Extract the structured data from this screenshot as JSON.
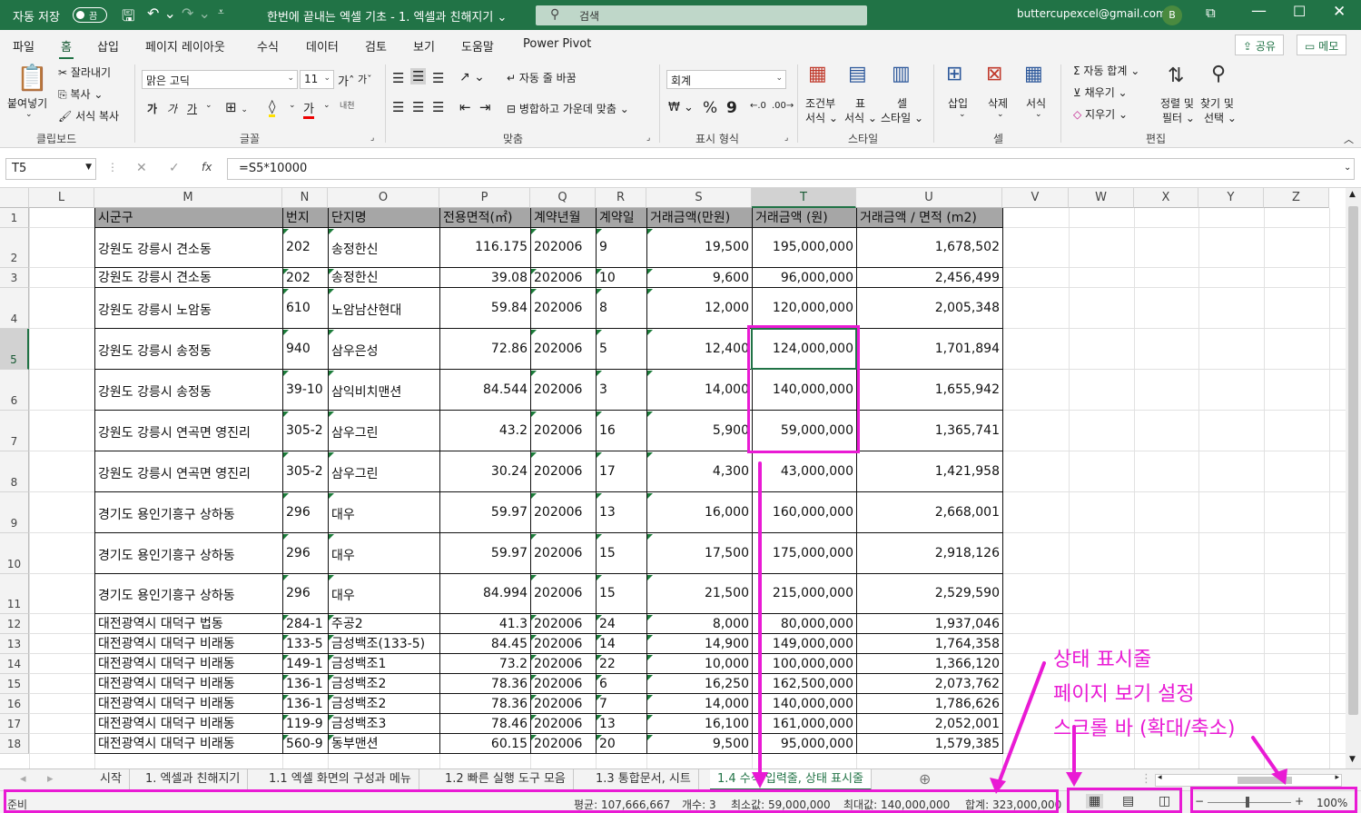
{
  "titlebar": {
    "autosave_label": "자동 저장",
    "autosave_state": "끔",
    "document_title": "한번에 끝내는 엑셀 기초 - 1. 엑셀과 친해지기",
    "search_placeholder": "검색",
    "account_email": "buttercupexcel@gmail.com",
    "avatar_initial": "B",
    "accent_color": "#217346"
  },
  "ribbon_tabs": [
    "파일",
    "홈",
    "삽입",
    "페이지 레이아웃",
    "수식",
    "데이터",
    "검토",
    "보기",
    "도움말",
    "Power Pivot"
  ],
  "share_label": "공유",
  "memo_label": "메모",
  "ribbon": {
    "clipboard": {
      "paste": "붙여넣기",
      "cut": "잘라내기",
      "copy": "복사",
      "format_painter": "서식 복사",
      "group": "클립보드"
    },
    "font": {
      "name": "맑은 고딕",
      "size": "11",
      "bold": "가",
      "italic": "가",
      "underline": "가",
      "phonetic": "내천",
      "group": "글꼴"
    },
    "alignment": {
      "wrap": "자동 줄 바꿈",
      "merge": "병합하고 가운데 맞춤",
      "group": "맞춤"
    },
    "number": {
      "format": "회계",
      "percent": "%",
      "comma": "9",
      "group": "표시 형식"
    },
    "styles": {
      "conditional": "조건부",
      "conditional2": "서식",
      "table": "표",
      "table2": "서식",
      "cell": "셀",
      "cell2": "스타일",
      "group": "스타일"
    },
    "cells": {
      "insert": "삽입",
      "delete": "삭제",
      "format": "서식",
      "group": "셀"
    },
    "editing": {
      "autosum": "자동 합계",
      "fill": "채우기",
      "clear": "지우기",
      "sort1": "정렬 및",
      "sort2": "필터",
      "find1": "찾기 및",
      "find2": "선택",
      "group": "편집"
    }
  },
  "formula_bar": {
    "name_box": "T5",
    "cancel": "✕",
    "enter": "✓",
    "fx": "fx",
    "formula": "=S5*10000"
  },
  "columns": [
    "L",
    "M",
    "N",
    "O",
    "P",
    "Q",
    "R",
    "S",
    "T",
    "U",
    "V",
    "W",
    "X",
    "Y",
    "Z"
  ],
  "table_header": [
    "시군구",
    "번지",
    "단지명",
    "전용면적(㎡)",
    "계약년월",
    "계약일",
    "거래금액(만원)",
    "거래금액 (원)",
    "거래금액 / 면적 (m2)"
  ],
  "rows": [
    {
      "n": "2",
      "cells": [
        "강원도 강릉시 견소동",
        "202",
        "송정한신",
        "116.175",
        "202006",
        "9",
        "19,500",
        "195,000,000",
        "1,678,502"
      ]
    },
    {
      "n": "3",
      "cells": [
        "강원도 강릉시 견소동",
        "202",
        "송정한신",
        "39.08",
        "202006",
        "10",
        "9,600",
        "96,000,000",
        "2,456,499"
      ]
    },
    {
      "n": "4",
      "cells": [
        "강원도 강릉시 노암동",
        "610",
        "노암남산현대",
        "59.84",
        "202006",
        "8",
        "12,000",
        "120,000,000",
        "2,005,348"
      ]
    },
    {
      "n": "5",
      "cells": [
        "강원도 강릉시 송정동",
        "940",
        "삼우은성",
        "72.86",
        "202006",
        "5",
        "12,400",
        "124,000,000",
        "1,701,894"
      ]
    },
    {
      "n": "6",
      "cells": [
        "강원도 강릉시 송정동",
        "39-10",
        "삼익비치맨션",
        "84.544",
        "202006",
        "3",
        "14,000",
        "140,000,000",
        "1,655,942"
      ]
    },
    {
      "n": "7",
      "cells": [
        "강원도 강릉시 연곡면 영진리",
        "305-2",
        "삼우그린",
        "43.2",
        "202006",
        "16",
        "5,900",
        "59,000,000",
        "1,365,741"
      ]
    },
    {
      "n": "8",
      "cells": [
        "강원도 강릉시 연곡면 영진리",
        "305-2",
        "삼우그린",
        "30.24",
        "202006",
        "17",
        "4,300",
        "43,000,000",
        "1,421,958"
      ]
    },
    {
      "n": "9",
      "cells": [
        "경기도 용인기흥구 상하동",
        "296",
        "대우",
        "59.97",
        "202006",
        "13",
        "16,000",
        "160,000,000",
        "2,668,001"
      ]
    },
    {
      "n": "10",
      "cells": [
        "경기도 용인기흥구 상하동",
        "296",
        "대우",
        "59.97",
        "202006",
        "15",
        "17,500",
        "175,000,000",
        "2,918,126"
      ]
    },
    {
      "n": "11",
      "cells": [
        "경기도 용인기흥구 상하동",
        "296",
        "대우",
        "84.994",
        "202006",
        "15",
        "21,500",
        "215,000,000",
        "2,529,590"
      ]
    },
    {
      "n": "12",
      "cells": [
        "대전광역시 대덕구 법동",
        "284-1",
        "주공2",
        "41.3",
        "202006",
        "24",
        "8,000",
        "80,000,000",
        "1,937,046"
      ]
    },
    {
      "n": "13",
      "cells": [
        "대전광역시 대덕구 비래동",
        "133-5",
        "금성백조(133-5)",
        "84.45",
        "202006",
        "14",
        "14,900",
        "149,000,000",
        "1,764,358"
      ]
    },
    {
      "n": "14",
      "cells": [
        "대전광역시 대덕구 비래동",
        "149-1",
        "금성백조1",
        "73.2",
        "202006",
        "22",
        "10,000",
        "100,000,000",
        "1,366,120"
      ]
    },
    {
      "n": "15",
      "cells": [
        "대전광역시 대덕구 비래동",
        "136-1",
        "금성백조2",
        "78.36",
        "202006",
        "6",
        "16,250",
        "162,500,000",
        "2,073,762"
      ]
    },
    {
      "n": "16",
      "cells": [
        "대전광역시 대덕구 비래동",
        "136-1",
        "금성백조2",
        "78.36",
        "202006",
        "7",
        "14,000",
        "140,000,000",
        "1,786,626"
      ]
    },
    {
      "n": "17",
      "cells": [
        "대전광역시 대덕구 비래동",
        "119-9",
        "금성백조3",
        "78.46",
        "202006",
        "13",
        "16,100",
        "161,000,000",
        "2,052,001"
      ]
    },
    {
      "n": "18",
      "cells": [
        "대전광역시 대덕구 비래동",
        "560-9",
        "동부맨션",
        "60.15",
        "202006",
        "20",
        "9,500",
        "95,000,000",
        "1,579,385"
      ]
    }
  ],
  "sheet_tabs": [
    "시작",
    "1. 엑셀과 친해지기",
    "1.1 엑셀 화면의 구성과 메뉴",
    "1.2 빠른 실행 도구 모음",
    "1.3 통합문서, 시트",
    "1.4 수식 입력줄, 상태 표시줄"
  ],
  "active_sheet_index": 5,
  "status": {
    "mode": "준비",
    "average": "평균:  107,666,667",
    "count": "개수: 3",
    "min": "최소값:  59,000,000",
    "max": "최대값:  140,000,000",
    "sum": "합계:  323,000,000",
    "zoom": "100%"
  },
  "annotations": [
    "상태 표시줄",
    "페이지 보기 설정",
    "스크롤 바 (확대/축소)"
  ],
  "annotation_color": "#e91ad4"
}
